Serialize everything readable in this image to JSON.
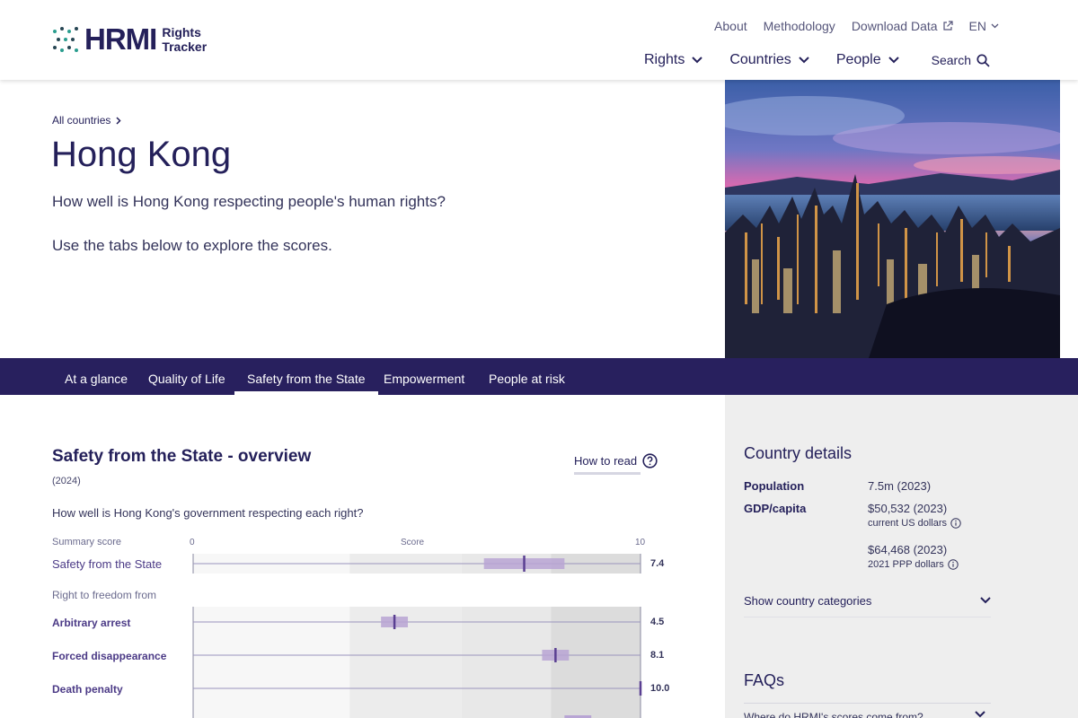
{
  "header": {
    "logo_main": "HRMI",
    "logo_sub_line1": "Rights",
    "logo_sub_line2": "Tracker",
    "top_links": [
      "About",
      "Methodology",
      "Download Data",
      "EN"
    ],
    "nav": [
      "Rights",
      "Countries",
      "People",
      "Search"
    ]
  },
  "hero": {
    "breadcrumb": "All countries",
    "title": "Hong Kong",
    "question": "How well is Hong Kong respecting people's human rights?",
    "hint": "Use the tabs below to explore the scores."
  },
  "tabs": [
    "At a glance",
    "Quality of Life",
    "Safety from the State",
    "Empowerment",
    "People at risk"
  ],
  "active_tab": "Safety from the State",
  "overview": {
    "title": "Safety from the State - overview",
    "year": "(2024)",
    "how_to_read": "How to read",
    "question": "How well is Hong Kong's government respecting each right?",
    "summary_label": "Summary score",
    "axis_label": "Score",
    "axis_min": "0",
    "axis_max": "10",
    "section_label": "Right to freedom from"
  },
  "chart_data": {
    "type": "scatter",
    "title": "Safety from the State - overview",
    "xlabel": "Score",
    "xlim": [
      0,
      10
    ],
    "rows": [
      {
        "label": "Safety from the State",
        "score": 7.4,
        "score_text": "7.4",
        "low": 6.5,
        "high": 8.3,
        "summary": true
      },
      {
        "label": "Arbitrary arrest",
        "score": 4.5,
        "score_text": "4.5",
        "low": 4.2,
        "high": 4.8,
        "summary": false
      },
      {
        "label": "Forced disappearance",
        "score": 8.1,
        "score_text": "8.1",
        "low": 7.8,
        "high": 8.4,
        "summary": false
      },
      {
        "label": "Death penalty",
        "score": 10.0,
        "score_text": "10.0",
        "low": 10.0,
        "high": 10.0,
        "summary": false
      }
    ],
    "bands": [
      3.5,
      6,
      8
    ],
    "colors": {
      "bar": "#b8a5d4",
      "marker": "#5a3f92",
      "band_light": "#f3f3f3",
      "band_mid": "#e8e8e8",
      "band_dark": "#dcdcdc"
    }
  },
  "side": {
    "title": "Country details",
    "population_label": "Population",
    "population_value": "7.5m (2023)",
    "gdp_label": "GDP/capita",
    "gdp_value1": "$50,532 (2023)",
    "gdp_note1": "current US dollars",
    "gdp_value2": "$64,468 (2023)",
    "gdp_note2": "2021 PPP dollars",
    "categories": "Show country categories",
    "faqs": "FAQs",
    "faq_q": "Where do HRMI's scores come from?"
  },
  "colors": {
    "navy": "#28205e",
    "accent": "#5a3f92"
  }
}
